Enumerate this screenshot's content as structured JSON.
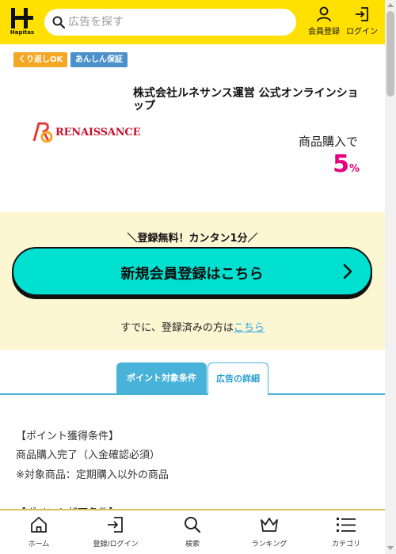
{
  "header": {
    "logo_text": "Hapitas",
    "search_placeholder": "広告を探す",
    "member_register_label": "会員登録",
    "login_label": "ログイン"
  },
  "badges": {
    "repeat": "くり返しOK",
    "safe": "あんしん保証"
  },
  "shop": {
    "logo_text": "RENAISSANCE",
    "title": "株式会社ルネサンス運営 公式オンラインショップ",
    "purchase_label": "商品購入で",
    "rate_value": "5",
    "rate_unit": "%"
  },
  "register": {
    "free_note": "＼登録無料！カンタン1分／",
    "signup_label": "新規会員登録はこちら",
    "existing_prefix": "すでに、登録済みの方は",
    "existing_link": "こちら"
  },
  "tabs": {
    "active": "ポイント対象条件",
    "inactive": "広告の詳細"
  },
  "conditions": {
    "heading": "【ポイント獲得条件】",
    "line1": "商品購入完了（入金確認必須）",
    "line2": "※対象商品：定期購入以外の商品",
    "line3": "【ポイント却下条件】"
  },
  "bottom_nav": {
    "home": "ホーム",
    "login": "登録/ログイン",
    "search": "検索",
    "ranking": "ランキング",
    "category": "カテゴリ"
  },
  "colors": {
    "header_bg": "#ffe000",
    "accent_teal": "#00e0d0",
    "rate_pink": "#e6007e",
    "tab_blue": "#48b2d8"
  }
}
